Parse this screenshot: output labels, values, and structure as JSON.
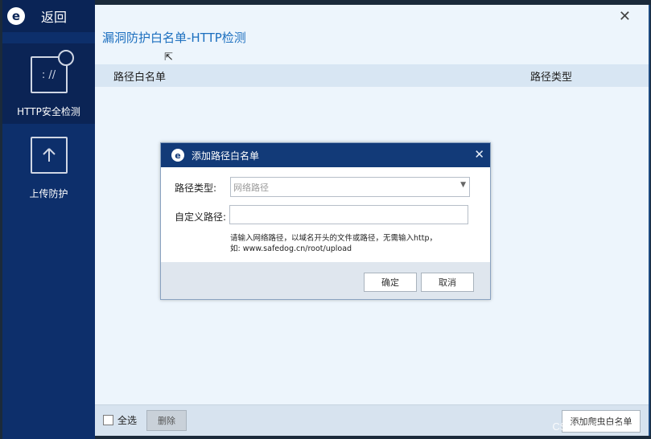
{
  "sidebar": {
    "back_label": "返回",
    "items": [
      {
        "label": "HTTP安全检测",
        "icon": "http-security-icon",
        "icon_text": ": //"
      },
      {
        "label": "上传防护",
        "icon": "upload-icon"
      }
    ]
  },
  "main": {
    "title": "漏洞防护白名单-HTTP检测",
    "columns": [
      "路径白名单",
      "路径类型"
    ],
    "footer": {
      "select_all_label": "全选",
      "delete_label": "删除",
      "add_label": "添加爬虫白名单"
    }
  },
  "modal": {
    "title": "添加路径白名单",
    "path_type_label": "路径类型:",
    "path_type_value": "网络路径",
    "custom_path_label": "自定义路径:",
    "custom_path_value": "",
    "hint_line1": "请输入网络路径，以域名开头的文件或路径，无需输入http，",
    "hint_line2": "如: www.safedog.cn/root/upload",
    "ok_label": "确定",
    "cancel_label": "取消"
  },
  "watermark": "CSDN @IsecNoob",
  "colors": {
    "sidebar_bg": "#0d2f6b",
    "modal_title_bg": "#123a78",
    "title_text": "#1c6fbf",
    "window_bg": "#edf5fc"
  }
}
